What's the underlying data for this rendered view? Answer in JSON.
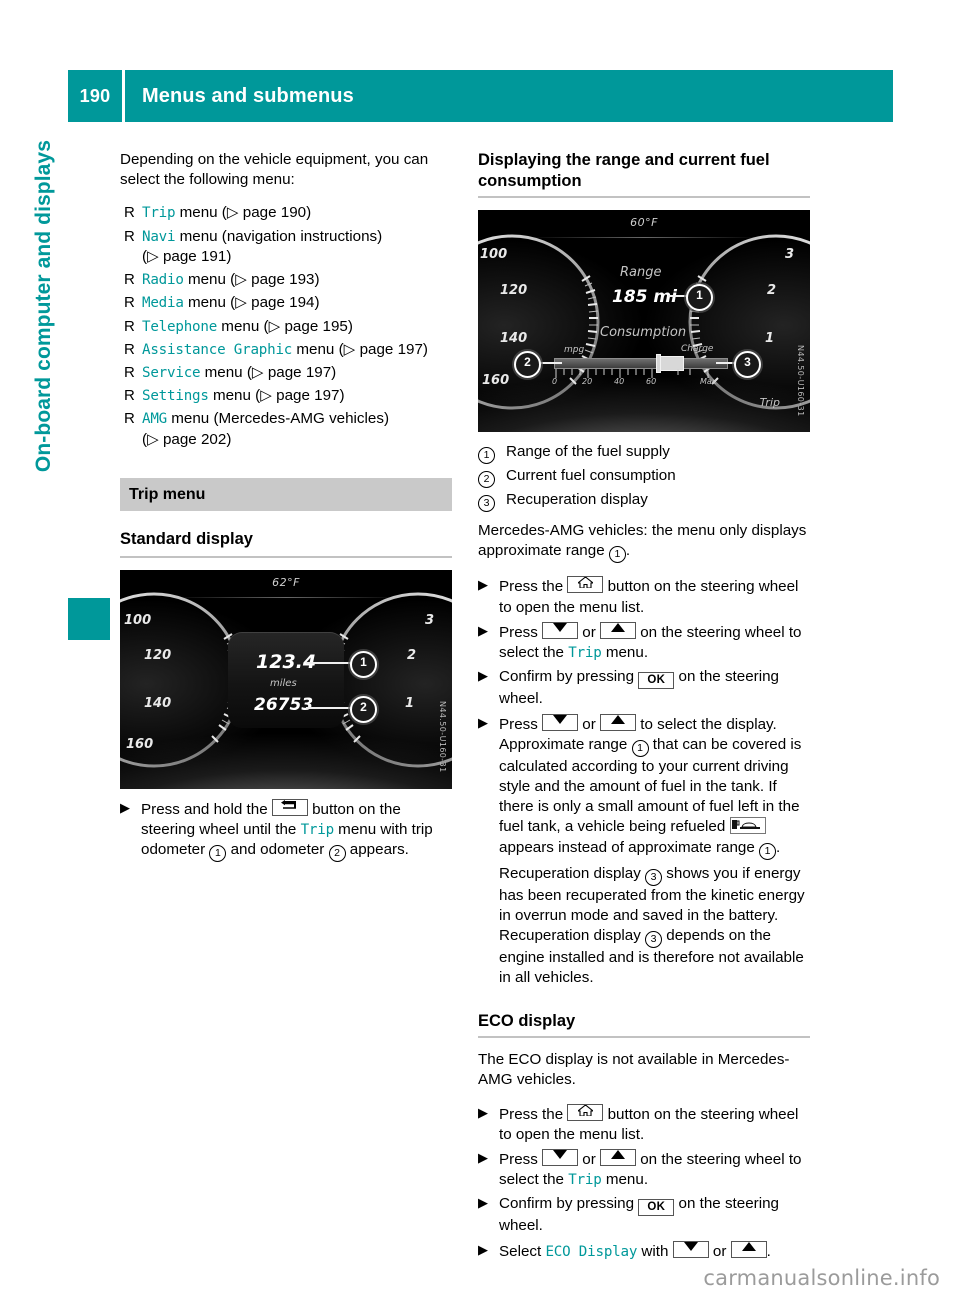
{
  "header": {
    "page_number": "190",
    "title": "Menus and submenus"
  },
  "chapter_tab": {
    "label": "On-board computer and displays"
  },
  "left_column": {
    "intro": "Depending on the vehicle equipment, you can select the following menu:",
    "menu_items": [
      {
        "bullet": "R",
        "name": "Trip",
        "rest": " menu (",
        "ref_arrow": "▷",
        "ref": " page 190)",
        "wrap": ""
      },
      {
        "bullet": "R",
        "name": "Navi",
        "rest": " menu (navigation instructions)",
        "ref_arrow": "▷",
        "ref": " page 191)",
        "wrap": "("
      },
      {
        "bullet": "R",
        "name": "Radio",
        "rest": " menu (",
        "ref_arrow": "▷",
        "ref": " page 193)",
        "wrap": ""
      },
      {
        "bullet": "R",
        "name": "Media",
        "rest": " menu (",
        "ref_arrow": "▷",
        "ref": " page 194)",
        "wrap": ""
      },
      {
        "bullet": "R",
        "name": "Telephone",
        "rest": " menu (",
        "ref_arrow": "▷",
        "ref": " page 195)",
        "wrap": ""
      },
      {
        "bullet": "R",
        "name": "Assistance Graphic",
        "rest": " menu (",
        "ref_arrow": "▷",
        "ref": " page 197)",
        "wrap": ""
      },
      {
        "bullet": "R",
        "name": "Service",
        "rest": " menu (",
        "ref_arrow": "▷",
        "ref": " page 197)",
        "wrap": ""
      },
      {
        "bullet": "R",
        "name": "Settings",
        "rest": " menu (",
        "ref_arrow": "▷",
        "ref": " page 197)",
        "wrap": ""
      },
      {
        "bullet": "R",
        "name": "AMG",
        "rest": " menu (Mercedes-AMG vehicles)",
        "ref_arrow": "▷",
        "ref": " page 202)",
        "wrap": "("
      }
    ],
    "grey_heading": "Trip menu",
    "sub_heading": "Standard display",
    "figure": {
      "temperature": "62°F",
      "trip_odometer": "123.4",
      "unit": "miles",
      "odometer": "26753",
      "speed_ticks": [
        "100",
        "120",
        "140",
        "160"
      ],
      "rpm_ticks": [
        "3",
        "2",
        "1"
      ],
      "side_code": "N44.50-U160-31",
      "callouts": [
        "1",
        "2"
      ]
    },
    "step": {
      "arrow": "▶",
      "text_a": "Press and hold the ",
      "key": "back-key",
      "text_b": " button on the steering wheel until the ",
      "menu": "Trip",
      "text_c": " menu with trip odometer ",
      "num_a": "1",
      "text_d": " and odometer ",
      "num_b": "2",
      "text_e": " appears."
    }
  },
  "right_column": {
    "heading": "Displaying the range and current fuel consumption",
    "figure": {
      "temperature": "60°F",
      "range_label": "Range",
      "range_value": "185 mi",
      "consumption_label": "Consumption",
      "left_unit": "mpg",
      "right_unit": "Charge",
      "scale_ticks": [
        "0",
        "20",
        "40",
        "60",
        "Max"
      ],
      "trip_label": "Trip",
      "speed_ticks": [
        "100",
        "120",
        "140",
        "160"
      ],
      "rpm_ticks": [
        "3",
        "2",
        "1"
      ],
      "side_code": "N44.50-U160-31",
      "callouts": [
        "1",
        "2",
        "3"
      ]
    },
    "legend": [
      {
        "num": "1",
        "text": "Range of the fuel supply"
      },
      {
        "num": "2",
        "text": "Current fuel consumption"
      },
      {
        "num": "3",
        "text": "Recuperation display"
      }
    ],
    "amg_note_a": "Mercedes-AMG vehicles: the menu only displays approximate range ",
    "amg_note_num": "1",
    "amg_note_b": ".",
    "steps": [
      {
        "arrow": "▶",
        "text_a": "Press the ",
        "key": "home-key",
        "text_b": " button on the steering wheel to open the menu list."
      },
      {
        "arrow": "▶",
        "text_a": "Press ",
        "key_down": "down-key",
        "text_or": " or ",
        "key_up": "up-key",
        "text_b": " on the steering wheel to select the ",
        "menu": "Trip",
        "text_c": " menu."
      },
      {
        "arrow": "▶",
        "text_a": "Confirm by pressing ",
        "key_ok": "OK",
        "text_b": " on the steering wheel."
      }
    ],
    "long_step": {
      "arrow": "▶",
      "text_a": "Press ",
      "key_down": "down-key",
      "text_or": " or ",
      "key_up": "up-key",
      "text_b": " to select the display. Approximate range ",
      "num_a": "1",
      "text_c": " that can be covered is calculated according to your current driving style and the amount of fuel in the tank. If there is only a small amount of fuel left in the fuel tank, a vehicle being refueled ",
      "icon": "refuel-icon",
      "text_d": " appears instead of approximate range ",
      "num_b": "1",
      "text_e": "."
    },
    "recuperation": {
      "text_a": "Recuperation display ",
      "num_a": "3",
      "text_b": " shows you if energy has been recuperated from the kinetic energy in overrun mode and saved in the battery. Recuperation display ",
      "num_b": "3",
      "text_c": " depends on the engine installed and is therefore not available in all vehicles."
    },
    "eco": {
      "heading": "ECO display",
      "intro": "The ECO display is not available in Mercedes-AMG vehicles.",
      "steps": [
        {
          "arrow": "▶",
          "text_a": "Press the ",
          "key": "home-key",
          "text_b": " button on the steering wheel to open the menu list."
        },
        {
          "arrow": "▶",
          "text_a": "Press ",
          "key_down": "down-key",
          "text_or": " or ",
          "key_up": "up-key",
          "text_b": " on the steering wheel to select the ",
          "menu": "Trip",
          "text_c": " menu."
        },
        {
          "arrow": "▶",
          "text_a": "Confirm by pressing ",
          "key_ok": "OK",
          "text_b": " on the steering wheel."
        },
        {
          "arrow": "▶",
          "text_a": "Select ",
          "menu": "ECO Display",
          "text_b": " with ",
          "key_down": "down-key",
          "text_or": " or ",
          "key_up": "up-key",
          "text_c": "."
        }
      ]
    }
  },
  "watermark": "carmanualsonline.info",
  "colors": {
    "accent_teal": "#00989a",
    "grey_heading_bg": "#c9c9c9",
    "rule_grey": "#c2c2c2",
    "watermark_grey": "#9b9b9b"
  }
}
